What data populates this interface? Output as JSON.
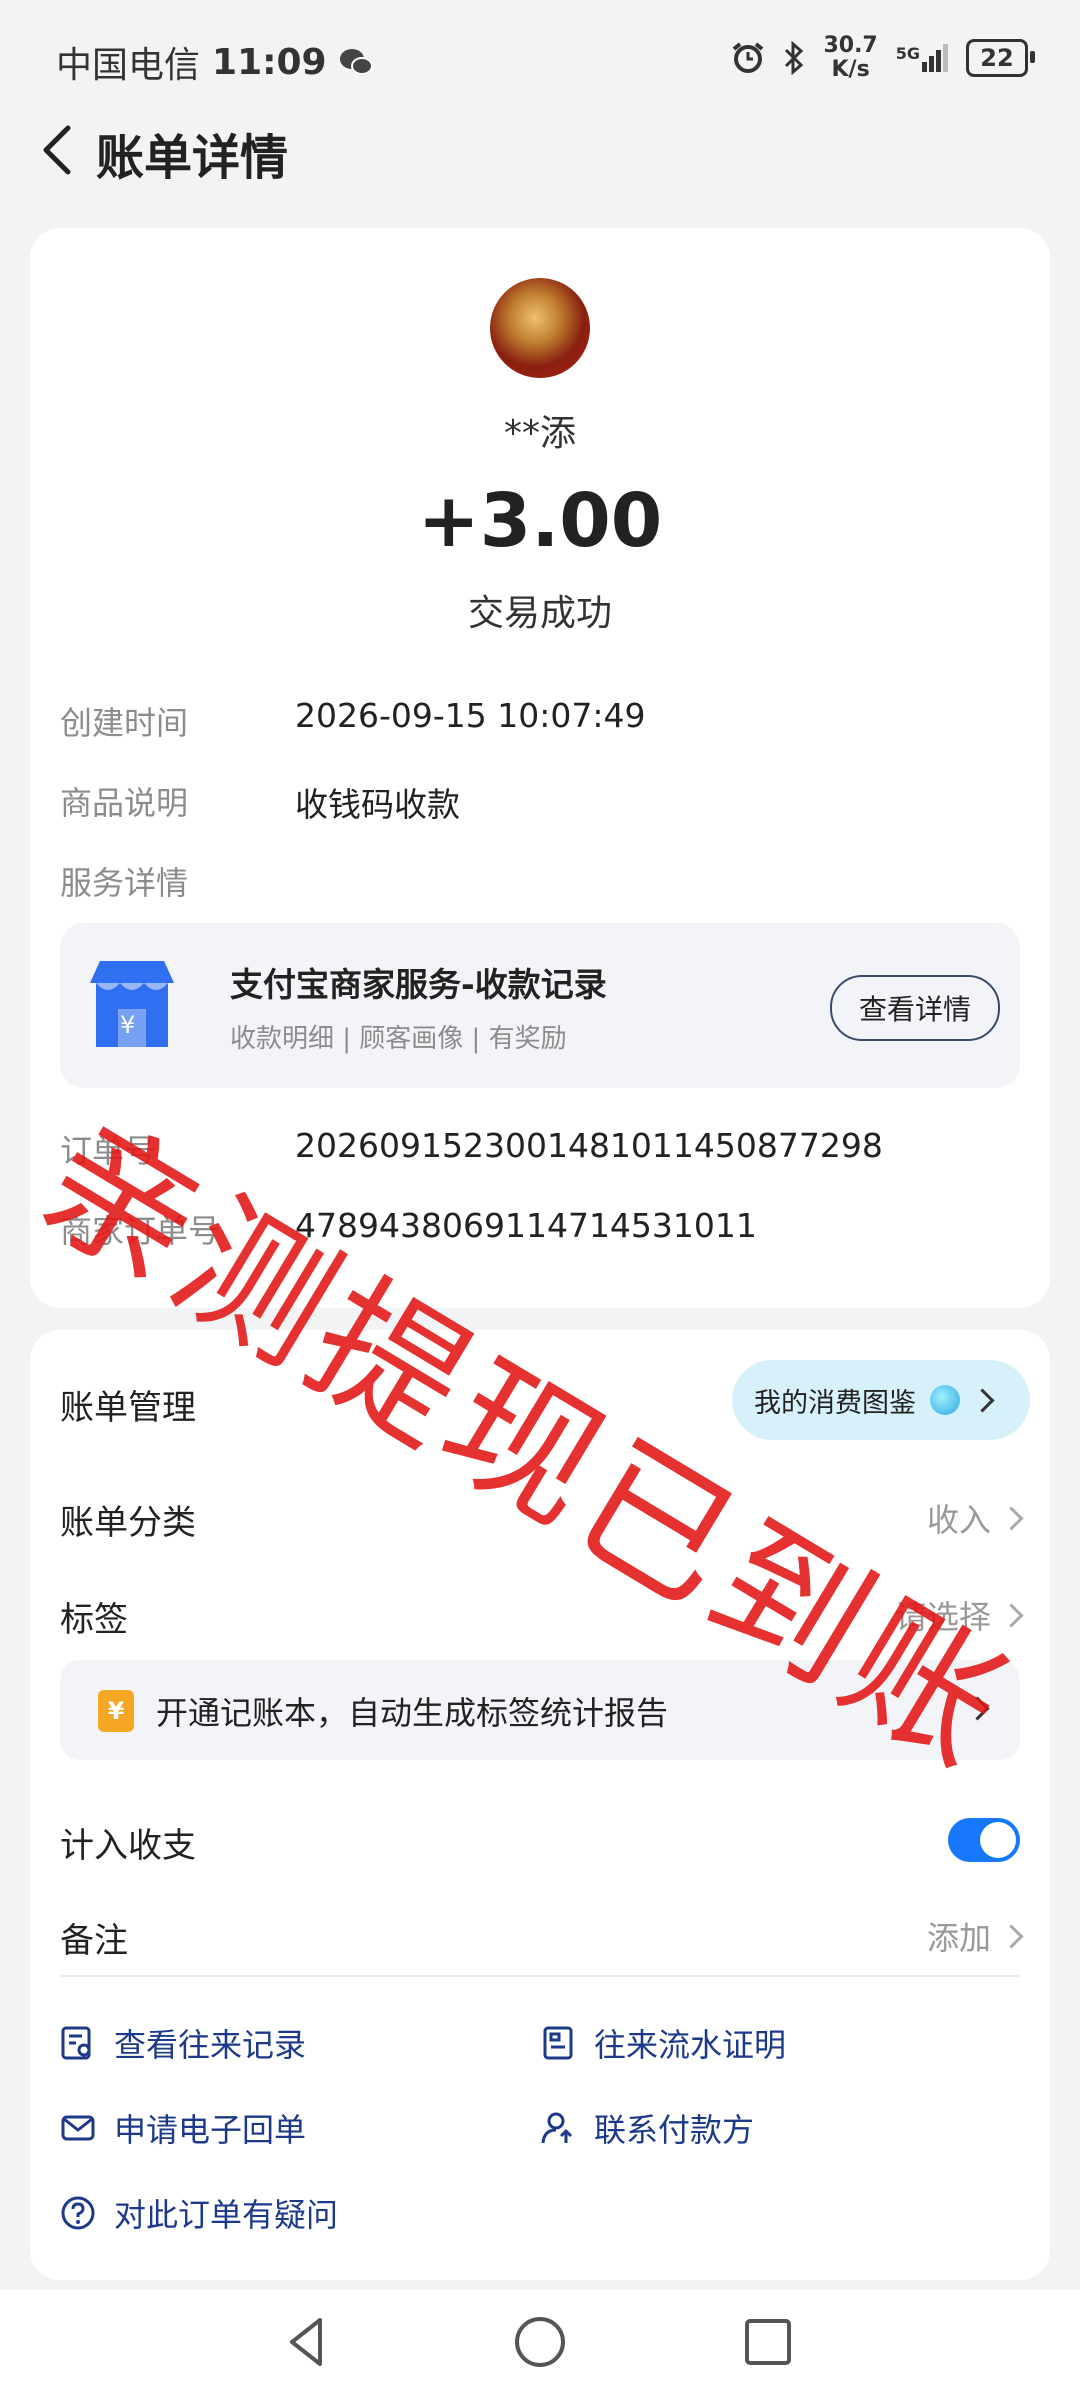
{
  "status_bar": {
    "carrier": "中国电信",
    "time": "11:09",
    "speed_value": "30.7",
    "speed_unit": "K/s",
    "network": "5G",
    "battery": "22"
  },
  "header": {
    "title": "账单详情"
  },
  "transaction": {
    "payer": "**添",
    "amount": "+3.00",
    "status": "交易成功",
    "created_label": "创建时间",
    "created_value": "2026-09-15 10:07:49",
    "product_label": "商品说明",
    "product_value": "收钱码收款",
    "service_label": "服务详情",
    "order_label": "订单号",
    "order_value": "2026091523001481011450877298",
    "merchant_order_label": "商家订单号",
    "merchant_order_value": "4789438069114714531011"
  },
  "service_card": {
    "title": "支付宝商家服务-收款记录",
    "subtitle": "收款明细 | 顾客画像 | 有奖励",
    "button": "查看详情"
  },
  "bill_management": {
    "title": "账单管理",
    "pill_label": "我的消费图鉴",
    "category_label": "账单分类",
    "category_value": "收入",
    "tag_label": "标签",
    "tag_value": "请选择",
    "promo_text": "开通记账本，自动生成标签统计报告",
    "promo_icon": "¥",
    "count_label": "计入收支",
    "count_enabled": true,
    "note_label": "备注",
    "note_value": "添加"
  },
  "links": {
    "history": "查看往来记录",
    "statement": "往来流水证明",
    "receipt": "申请电子回单",
    "contact": "联系付款方",
    "question": "对此订单有疑问"
  },
  "watermark": "亲测提现已到账",
  "colors": {
    "accent": "#1677ff",
    "watermark": "#e21414",
    "link": "#1d3a8a"
  }
}
